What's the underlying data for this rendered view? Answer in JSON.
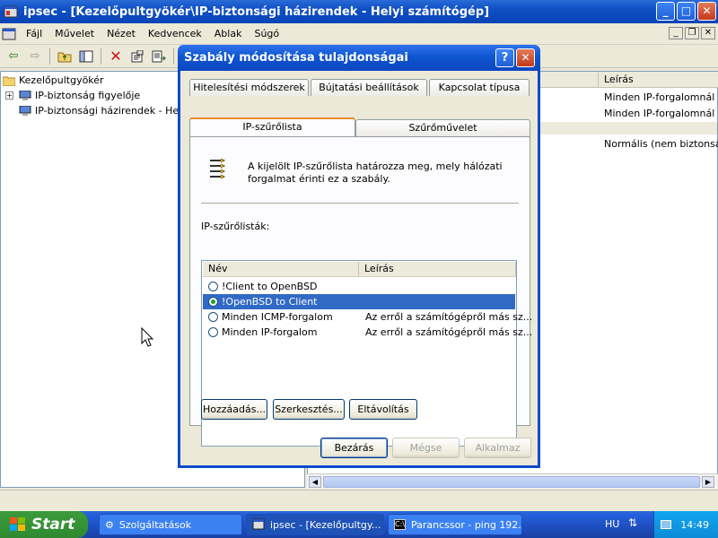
{
  "main_window": {
    "title": "ipsec - [Kezelőpultgyökér\\IP-biztonsági házirendek - Helyi számítógép]",
    "buttons": {
      "minimize": "_",
      "maximize": "□",
      "close": "✕"
    }
  },
  "menubar": {
    "items": [
      "Fájl",
      "Művelet",
      "Nézet",
      "Kedvencek",
      "Ablak",
      "Súgó"
    ]
  },
  "tree": {
    "root": "Kezelőpultgyökér",
    "items": [
      "IP-biztonság figyelője",
      "IP-biztonsági házirendek - Helyi s"
    ]
  },
  "right_pane": {
    "column_leiras": "Leírás",
    "rows": [
      "Minden IP-forgalomnál min",
      "Minden IP-forgalomnál min",
      "Normális (nem biztonságos"
    ]
  },
  "dialog": {
    "title": "Szabály módosítása tulajdonságai",
    "help_button": "?",
    "close_button": "✕",
    "tabs": {
      "row1": [
        "Hitelesítési módszerek",
        "Bújtatási beállítások",
        "Kapcsolat típusa"
      ],
      "row2": [
        "IP-szűrőlista",
        "Szűrőművelet"
      ]
    },
    "description": "A kijelölt IP-szűrőlista határozza meg, mely hálózati forgalmat érinti ez a szabály.",
    "list_label": "IP-szűrőlisták:",
    "list": {
      "columns": [
        "Név",
        "Leírás"
      ],
      "rows": [
        {
          "name": "!Client to OpenBSD",
          "desc": "",
          "selected": false
        },
        {
          "name": "!OpenBSD to Client",
          "desc": "",
          "selected": true
        },
        {
          "name": "Minden ICMP-forgalom",
          "desc": "Az erről a számítógépről más sz...",
          "selected": false
        },
        {
          "name": "Minden IP-forgalom",
          "desc": "Az erről a számítógépről más sz...",
          "selected": false
        }
      ]
    },
    "buttons": {
      "add": "Hozzáadás...",
      "edit": "Szerkesztés...",
      "remove": "Eltávolítás",
      "close": "Bezárás",
      "cancel": "Mégse",
      "apply": "Alkalmaz"
    }
  },
  "taskbar": {
    "start": "Start",
    "tasks": [
      "Szolgáltatások",
      "ipsec - [Kezelőpultgy...",
      "Parancssor - ping 192...."
    ],
    "lang": "HU",
    "clock": "14:49"
  },
  "colors": {
    "title_blue": "#0a44b6",
    "selection": "#316ac5",
    "taskbar": "#245edb",
    "start_green": "#2f8a2f"
  }
}
